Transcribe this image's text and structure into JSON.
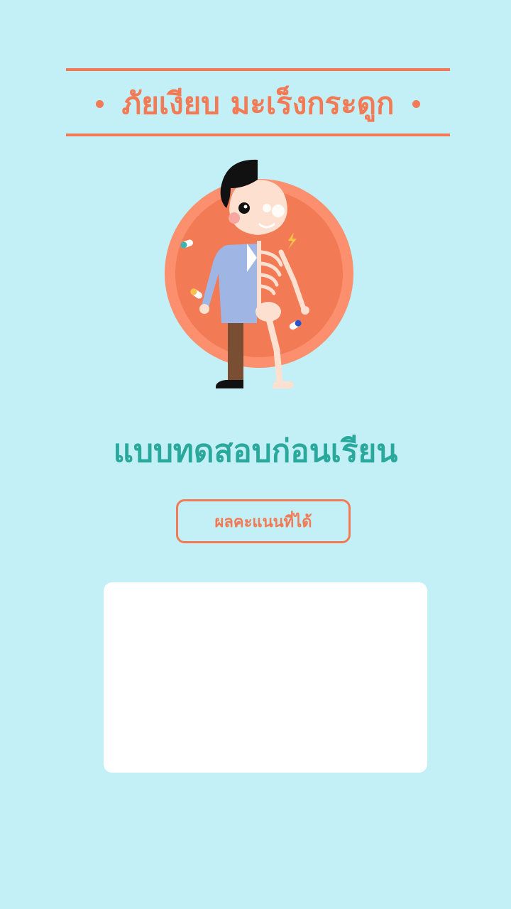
{
  "header": {
    "title": "ภัยเงียบ มะเร็งกระดูก"
  },
  "hero": {
    "illustration": "half-man-half-skeleton-illustration"
  },
  "main": {
    "page_title": "แบบทดสอบก่อนเรียน",
    "score_button_label": "ผลคะแนนที่ได้",
    "score_value": ""
  },
  "colors": {
    "background": "#c3eff7",
    "accent": "#f27a55",
    "title": "#2aa89b",
    "panel": "#ffffff"
  }
}
